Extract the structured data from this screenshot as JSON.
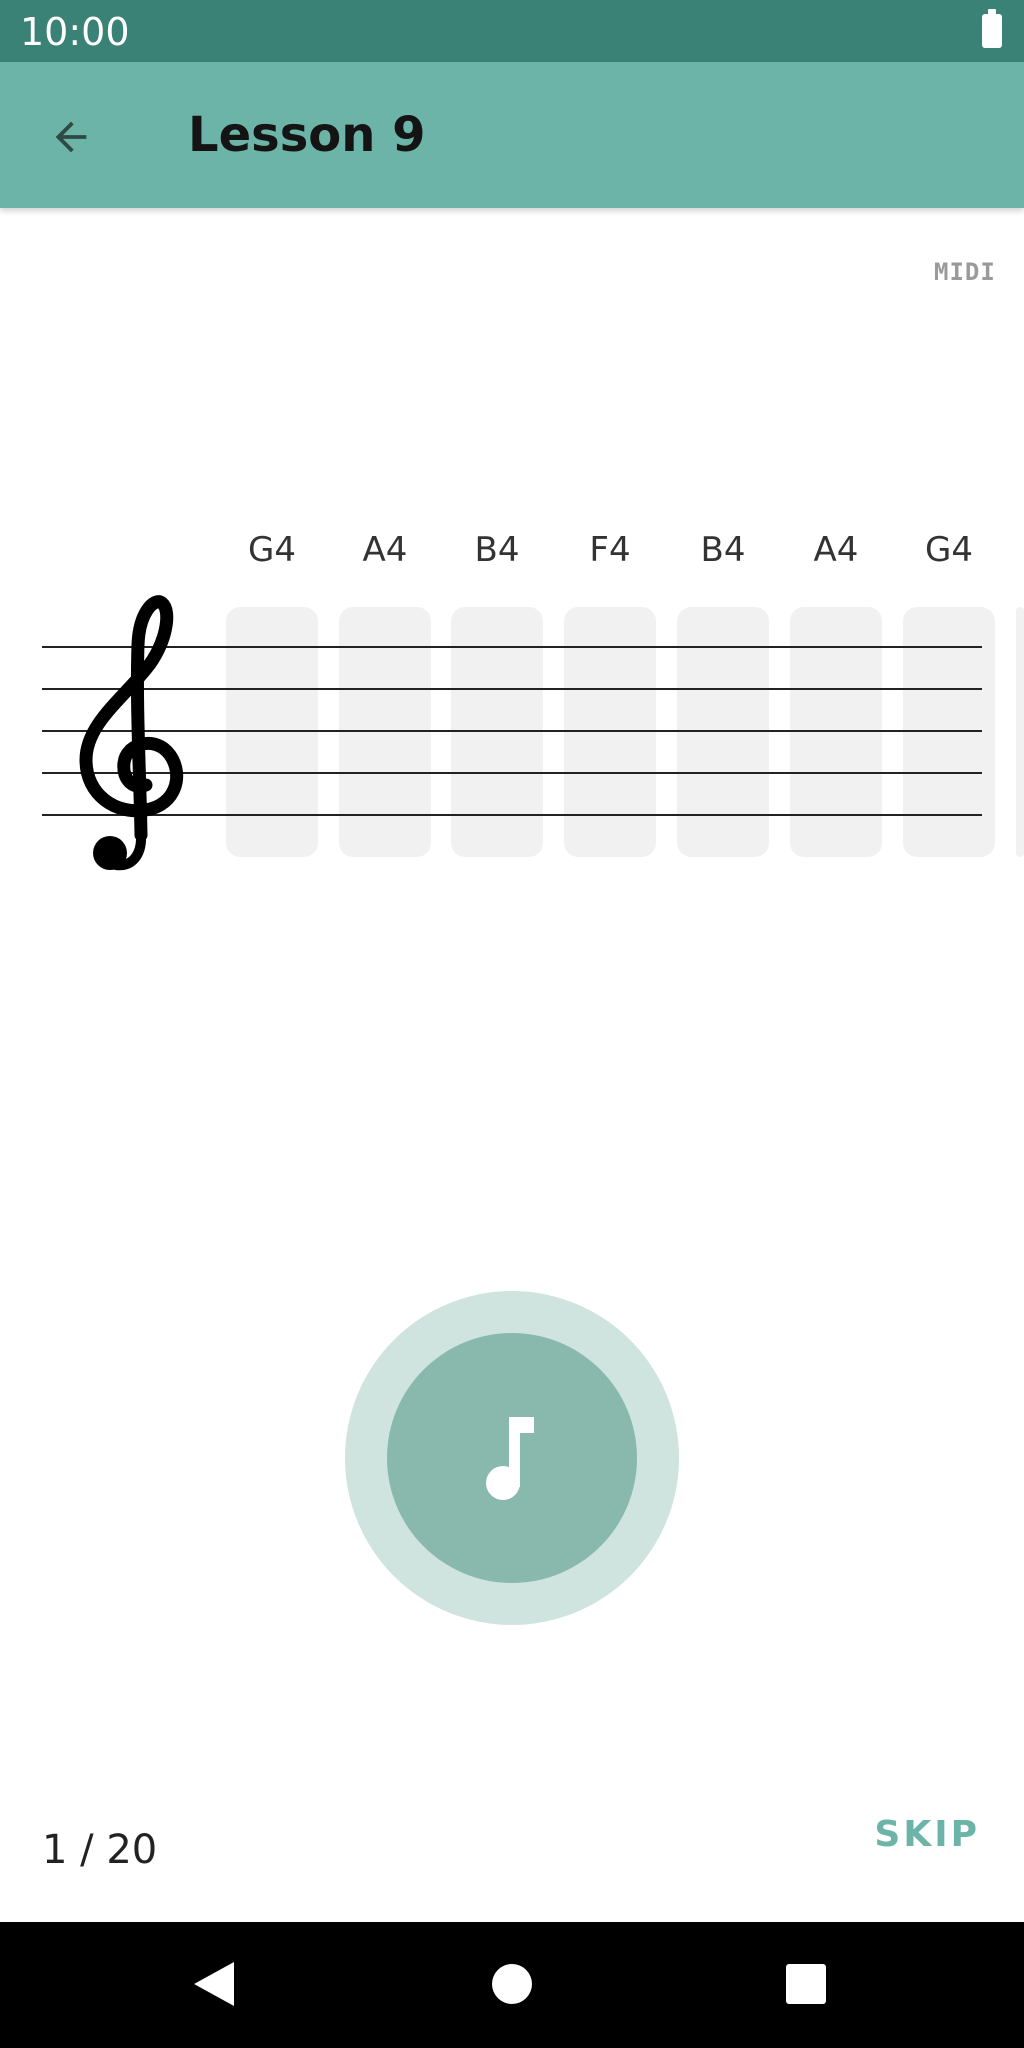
{
  "status_bar": {
    "time": "10:00",
    "battery_icon": "battery-full-icon"
  },
  "app_bar": {
    "back_icon": "arrow-back-icon",
    "title": "Lesson 9"
  },
  "midi_badge": "MIDI",
  "notes": [
    "G4",
    "A4",
    "B4",
    "F4",
    "B4",
    "A4",
    "G4"
  ],
  "staff": {
    "clef": "treble-clef-icon",
    "line_count": 5
  },
  "play_button": {
    "icon": "music-note-icon"
  },
  "footer": {
    "progress": "1 / 20",
    "skip_label": "SKIP"
  },
  "nav_bar": {
    "back": "nav-back-icon",
    "home": "nav-home-icon",
    "recents": "nav-recents-icon"
  },
  "colors": {
    "status_bar": "#3b8276",
    "app_bar": "#6cb4a7",
    "play_outer": "#cfe4df",
    "play_inner": "#89b8ac",
    "skip": "#6cb4a7",
    "slot": "#f1f1f1"
  }
}
